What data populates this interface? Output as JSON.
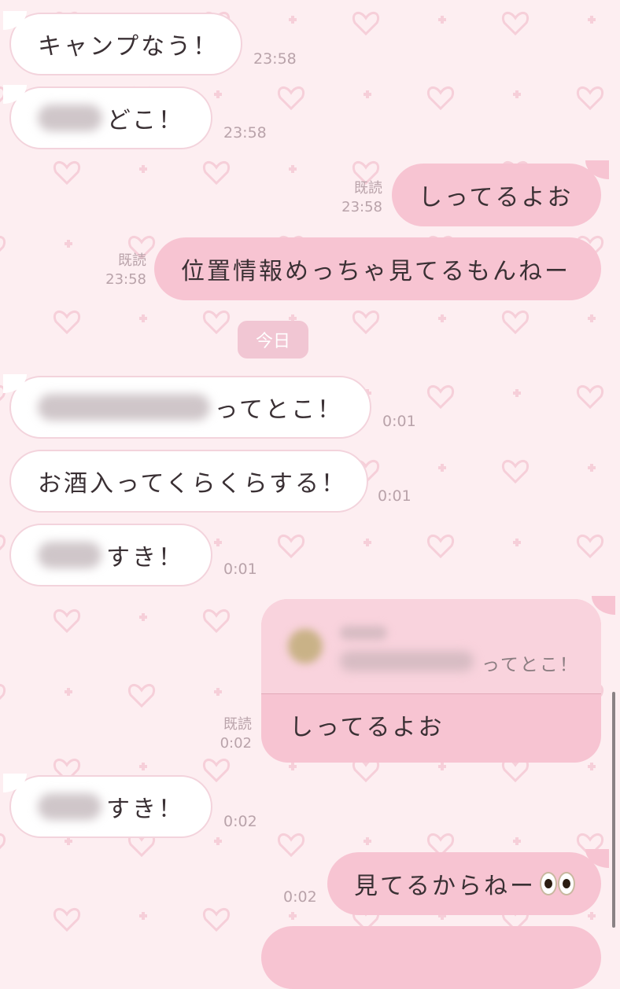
{
  "colors": {
    "background": "#fdeef1",
    "incoming_bubble": "#ffffff",
    "outgoing_bubble": "#f7c4d2",
    "meta_text": "#b9a3aa"
  },
  "messages": [
    {
      "text": "キャンプなう！",
      "time": "23:58"
    },
    {
      "text": "どこ！",
      "time": "23:58"
    },
    {
      "text": "しってるよお",
      "read": "既読",
      "time": "23:58"
    },
    {
      "text": "位置情報めっちゃ見てるもんねー",
      "read": "既読",
      "time": "23:58"
    },
    {
      "text": "ってとこ！",
      "time": "0:01"
    },
    {
      "text": "お酒入ってくらくらする！",
      "time": "0:01"
    },
    {
      "text": "すき！",
      "time": "0:01"
    },
    {
      "text": "すき！",
      "time": "0:02"
    },
    {
      "text": "見てるからねー",
      "time": "0:02",
      "emoji": "eyes-emoji"
    }
  ],
  "date_divider": "今日",
  "reply": {
    "quoted_text": "ってとこ！",
    "text": "しってるよお",
    "read": "既読",
    "time": "0:02"
  }
}
